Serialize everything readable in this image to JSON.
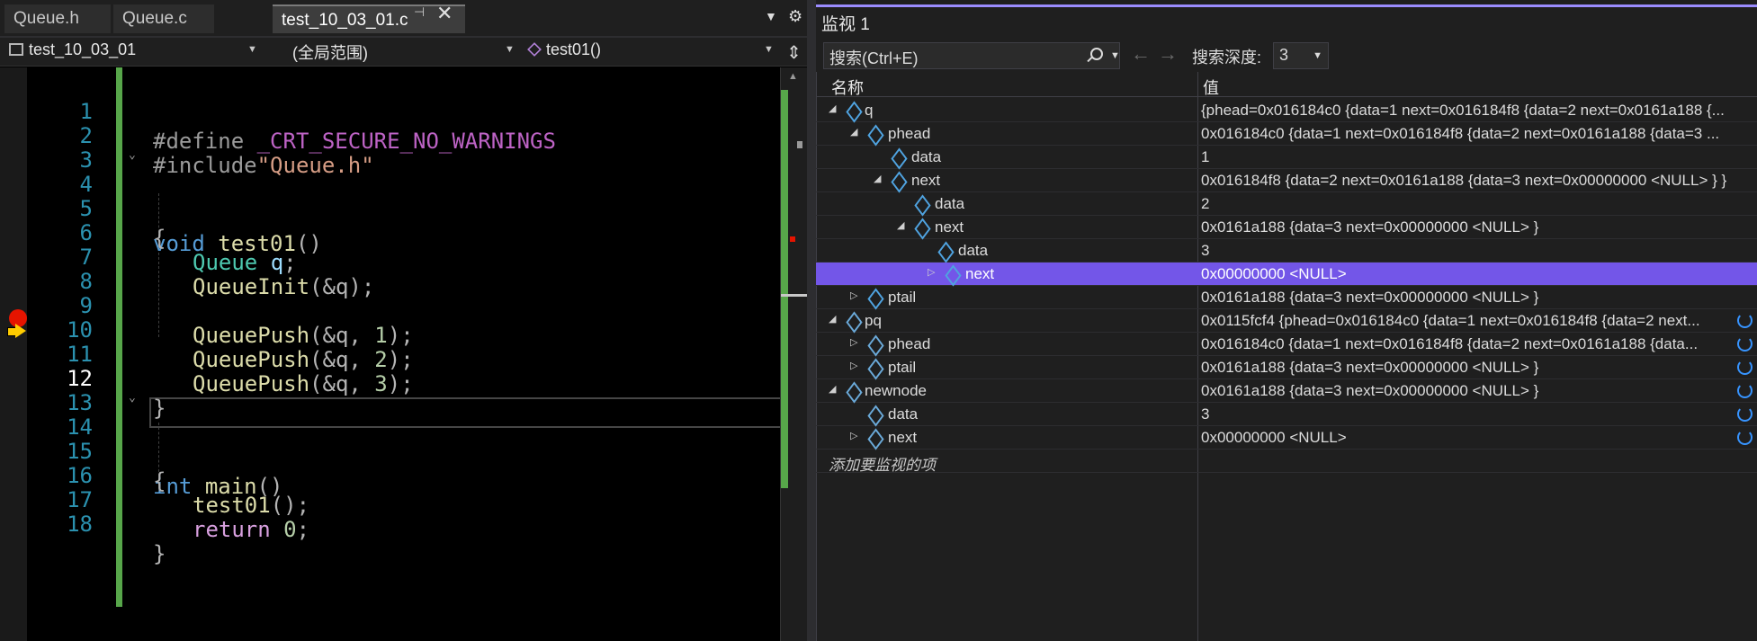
{
  "editor": {
    "tabs": [
      {
        "label": "Queue.h"
      },
      {
        "label": "Queue.c"
      },
      {
        "label": "test_10_03_01.c"
      }
    ],
    "nav": {
      "project": "test_10_03_01",
      "scope": "(全局范围)",
      "function": "test01()"
    },
    "current_line": 12,
    "breakpoint_line": 9,
    "lines": [
      {
        "n": "1"
      },
      {
        "n": "2"
      },
      {
        "n": "3"
      },
      {
        "n": "4"
      },
      {
        "n": "5"
      },
      {
        "n": "6"
      },
      {
        "n": "7"
      },
      {
        "n": "8"
      },
      {
        "n": "9"
      },
      {
        "n": "10"
      },
      {
        "n": "11"
      },
      {
        "n": "12"
      },
      {
        "n": "13"
      },
      {
        "n": "14"
      },
      {
        "n": "15"
      },
      {
        "n": "16"
      },
      {
        "n": "17"
      },
      {
        "n": "18"
      }
    ],
    "code": {
      "l1_kw": "#define",
      "l1_macro": "_CRT_SECURE_NO_WARNINGS",
      "l2_kw": "#include",
      "l2_str": "\"Queue.h\"",
      "l4_kw": "void",
      "l4_fn": "test01",
      "l4_paren": "()",
      "l5": "{",
      "l6_type": "Queue",
      "l6_var": "q",
      "l6_end": ";",
      "l7_fn": "QueueInit",
      "l7_args": "(&q);",
      "l9_fn": "QueuePush",
      "l9_a": "(&q, ",
      "l9_num": "1",
      "l9_end": ");",
      "l10_fn": "QueuePush",
      "l10_a": "(&q, ",
      "l10_num": "2",
      "l10_end": ");",
      "l11_fn": "QueuePush",
      "l11_a": "(&q, ",
      "l11_num": "3",
      "l11_end": ");",
      "l12": "}",
      "l14_kw": "int",
      "l14_fn": "main",
      "l14_paren": "()",
      "l15": "{",
      "l16_fn": "test01",
      "l16_end": "();",
      "l17_kw": "return",
      "l17_num": "0",
      "l17_end": ";",
      "l18": "}"
    }
  },
  "watch": {
    "title": "监视 1",
    "search_placeholder": "搜索(Ctrl+E)",
    "depth_label": "搜索深度:",
    "depth_value": "3",
    "col_name": "名称",
    "col_value": "值",
    "rows": [
      {
        "name": "q",
        "value": "{phead=0x016184c0 {data=1 next=0x016184f8 {data=2 next=0x0161a188 {..."
      },
      {
        "name": "phead",
        "value": "0x016184c0 {data=1 next=0x016184f8 {data=2 next=0x0161a188 {data=3 ..."
      },
      {
        "name": "data",
        "value": "1"
      },
      {
        "name": "next",
        "value": "0x016184f8 {data=2 next=0x0161a188 {data=3 next=0x00000000 <NULL> } }"
      },
      {
        "name": "data",
        "value": "2"
      },
      {
        "name": "next",
        "value": "0x0161a188 {data=3 next=0x00000000 <NULL> }"
      },
      {
        "name": "data",
        "value": "3"
      },
      {
        "name": "next",
        "value": "0x00000000 <NULL>"
      },
      {
        "name": "ptail",
        "value": "0x0161a188 {data=3 next=0x00000000 <NULL> }"
      },
      {
        "name": "pq",
        "value": "0x0115fcf4 {phead=0x016184c0 {data=1 next=0x016184f8 {data=2 next..."
      },
      {
        "name": "phead",
        "value": "0x016184c0 {data=1 next=0x016184f8 {data=2 next=0x0161a188 {data..."
      },
      {
        "name": "ptail",
        "value": "0x0161a188 {data=3 next=0x00000000 <NULL> }"
      },
      {
        "name": "newnode",
        "value": "0x0161a188 {data=3 next=0x00000000 <NULL> }"
      },
      {
        "name": "data",
        "value": "3"
      },
      {
        "name": "next",
        "value": "0x00000000 <NULL>"
      }
    ],
    "add_watch_placeholder": "添加要监视的项",
    "selected_row_index": 7
  },
  "colors": {
    "keyword": "#569cd6",
    "function": "#dcdcaa",
    "type": "#4ec9b0",
    "string": "#d69d85",
    "selection": "#7356e8",
    "breakpoint": "#e51400"
  }
}
